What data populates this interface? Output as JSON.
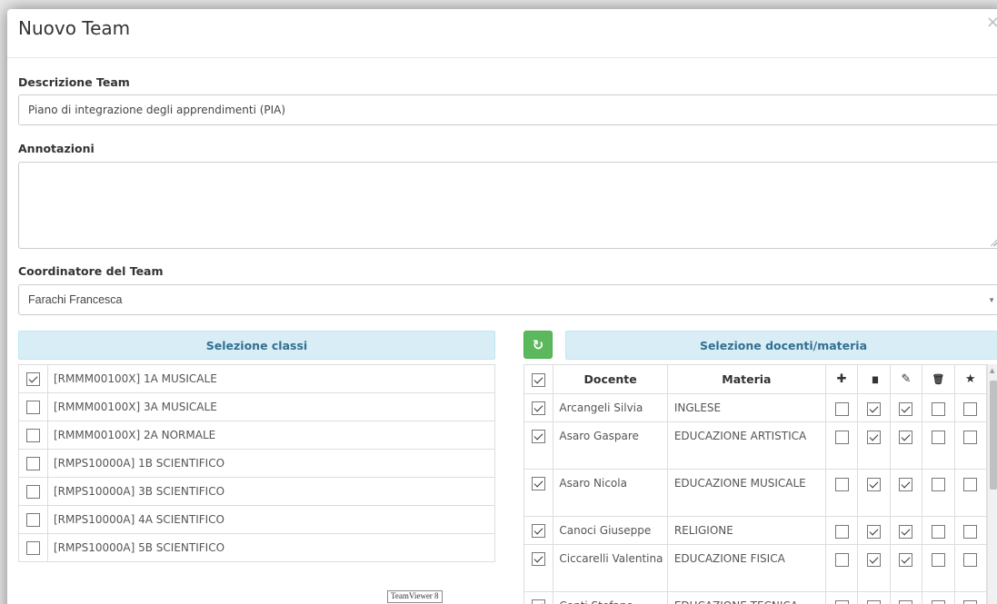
{
  "modal": {
    "title": "Nuovo Team",
    "close_label": "×"
  },
  "form": {
    "descrizione_label": "Descrizione Team",
    "descrizione_value": "Piano di integrazione degli apprendimenti (PIA)",
    "annotazioni_label": "Annotazioni",
    "annotazioni_value": "",
    "coordinatore_label": "Coordinatore del Team",
    "coordinatore_value": "Farachi Francesca"
  },
  "classes": {
    "header": "Selezione classi",
    "items": [
      {
        "label": "[RMMM00100X] 1A MUSICALE",
        "checked": true
      },
      {
        "label": "[RMMM00100X] 3A MUSICALE",
        "checked": false
      },
      {
        "label": "[RMMM00100X] 2A NORMALE",
        "checked": false
      },
      {
        "label": "[RMPS10000A] 1B SCIENTIFICO",
        "checked": false
      },
      {
        "label": "[RMPS10000A] 3B SCIENTIFICO",
        "checked": false
      },
      {
        "label": "[RMPS10000A] 4A SCIENTIFICO",
        "checked": false
      },
      {
        "label": "[RMPS10000A] 5B SCIENTIFICO",
        "checked": false
      }
    ]
  },
  "teachers": {
    "header": "Selezione docenti/materia",
    "columns": {
      "docente": "Docente",
      "materia": "Materia"
    },
    "perm_icons": [
      "plus-icon",
      "book-icon",
      "pencil-icon",
      "trash-icon",
      "star-icon"
    ],
    "perm_glyphs": [
      "✚",
      "▮▮",
      "✎",
      "🗑",
      "★"
    ],
    "rows": [
      {
        "docente": "Arcangeli Silvia",
        "materia": "INGLESE",
        "checked": true,
        "perms": [
          false,
          true,
          true,
          false,
          false
        ],
        "tall": false
      },
      {
        "docente": "Asaro Gaspare",
        "materia": "EDUCAZIONE ARTISTICA",
        "checked": true,
        "perms": [
          false,
          true,
          true,
          false,
          false
        ],
        "tall": true
      },
      {
        "docente": "Asaro Nicola",
        "materia": "EDUCAZIONE MUSICALE",
        "checked": true,
        "perms": [
          false,
          true,
          true,
          false,
          false
        ],
        "tall": true
      },
      {
        "docente": "Canoci Giuseppe",
        "materia": "RELIGIONE",
        "checked": true,
        "perms": [
          false,
          true,
          true,
          false,
          false
        ],
        "tall": false
      },
      {
        "docente": "Ciccarelli Valentina",
        "materia": "EDUCAZIONE FISICA",
        "checked": true,
        "perms": [
          false,
          true,
          true,
          false,
          false
        ],
        "tall": true
      },
      {
        "docente": "Conti Stefano",
        "materia": "EDUCAZIONE TECNICA",
        "checked": true,
        "perms": [
          false,
          true,
          true,
          false,
          false
        ],
        "tall": false
      }
    ]
  },
  "overlay": {
    "teamviewer_badge": "TeamViewer 8"
  }
}
